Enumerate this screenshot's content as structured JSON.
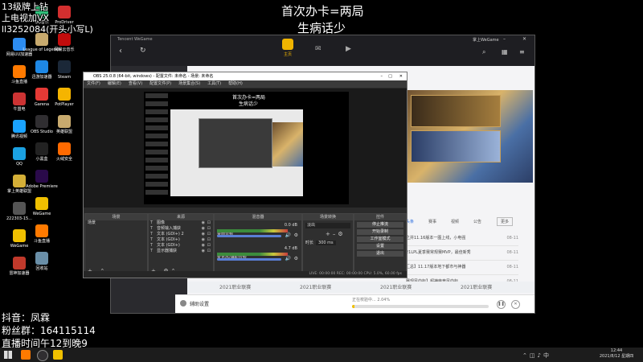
{
  "overlay": {
    "top_line1": "首次办卡=两局",
    "top_line2": "生病话少",
    "corner_line1": "13级牌上钻",
    "corner_line2": "上电视加VX",
    "corner_line3": "ll3252084(开头小写L)",
    "bottom_line1": "抖音：凤霖",
    "bottom_line2": "粉丝群：164115114",
    "bottom_line3": "直播时间午12到晚9"
  },
  "desktop_icons": [
    {
      "label": "网易UU加速器",
      "color": "#2d8cf0"
    },
    {
      "label": "斗鱼直播",
      "color": "#ff7a00"
    },
    {
      "label": "牛盟电",
      "color": "#cc3333"
    },
    {
      "label": "腾讯视频",
      "color": "#1aa3ff"
    },
    {
      "label": "QQ",
      "color": "#1ba1e2"
    },
    {
      "label": "掌上英雄联盟",
      "color": "#d4af37"
    },
    {
      "label": "222303-15...",
      "color": "#555555"
    },
    {
      "label": "WeGame",
      "color": "#f0c000"
    },
    {
      "label": "雷神加速器",
      "color": "#c0392b"
    },
    {
      "label": "QQ音乐",
      "color": "#31c27c"
    },
    {
      "label": "League of Legends",
      "color": "#c8aa6e"
    },
    {
      "label": "迅游加速器",
      "color": "#1e88e5"
    },
    {
      "label": "Garena",
      "color": "#e53935"
    },
    {
      "label": "OBS Studio",
      "color": "#302e31"
    },
    {
      "label": "小黑盒",
      "color": "#222222"
    },
    {
      "label": "Adobe Premiere",
      "color": "#2a0a4a"
    },
    {
      "label": "WeGame",
      "color": "#f0c000"
    },
    {
      "label": "斗鱼直播",
      "color": "#ff7a00"
    },
    {
      "label": "回收站",
      "color": "#6a8fa8"
    },
    {
      "label": "ProDriver",
      "color": "#d32f2f"
    },
    {
      "label": "网易云音乐",
      "color": "#c20c0c"
    },
    {
      "label": "Steam",
      "color": "#1b2838"
    },
    {
      "label": "PotPlayer",
      "color": "#f5b400"
    },
    {
      "label": "英雄联盟",
      "color": "#c8aa6e"
    },
    {
      "label": "火绒安全",
      "color": "#ff6a00"
    }
  ],
  "wegame": {
    "brand": "Tencent WeGame",
    "user": "掌上WeGame",
    "nav_home": "主页",
    "list_tabs": [
      "头条",
      "赛事",
      "视频",
      "公告"
    ],
    "more": "更多",
    "news": [
      {
        "title": "之井11.16版本一图上线，小电强",
        "date": "08-11"
      },
      {
        "title": "21LPL夏季赛常规赛MVP，最佳新秀",
        "date": "08-11"
      },
      {
        "title": "汇总】11.17版本地下都市与神器",
        "date": "08-11"
      },
      {
        "title": "赛现风向标】超神电竞风向标",
        "date": "08-11"
      }
    ],
    "more2": "更多",
    "bottom_cards": [
      "2021职业联赛",
      "2021职业联赛",
      "2021职业联赛",
      "2021职业联赛"
    ],
    "download_label": "辅助设置",
    "download_status": "正在校验中... 2.04%",
    "download_progress": 0.02
  },
  "obs": {
    "title": "OBS 25.0.8 (64-bit, windows) - 配置文件: 未命名 - 场景: 未命名",
    "menu": [
      "文件(F)",
      "编辑(E)",
      "查看(V)",
      "配置文件(P)",
      "场景集合(S)",
      "工具(T)",
      "帮助(H)"
    ],
    "preview_text1": "首次办卡=两局",
    "preview_text2": "生病话少",
    "scenes_header": "场景",
    "scenes": [
      "场景"
    ],
    "sources_header": "来源",
    "sources": [
      "图像",
      "音频输入捕获",
      "文本 (GDI+) 2",
      "文本 (GDI+)",
      "文本 (GDI+)",
      "显示器捕获"
    ],
    "mixer_header": "混音器",
    "mixer": [
      {
        "name": "桌面音频",
        "level": "0.0 dB"
      },
      {
        "name": "麦克风/辅助音频",
        "level": "4.7 dB"
      }
    ],
    "transition_header": "场景转换",
    "transition_type": "淡出",
    "duration_label": "时长",
    "duration_value": "300 ms",
    "controls_header": "控件",
    "controls": [
      "停止推流",
      "开始录制",
      "工作室模式",
      "设置",
      "退出"
    ],
    "status": "LIVE: 00:00:00   REC: 00:00:00   CPU: 5.0%, 60.00 fps"
  },
  "taskbar": {
    "time": "12:44",
    "date": "2021/8/12 星期四"
  }
}
